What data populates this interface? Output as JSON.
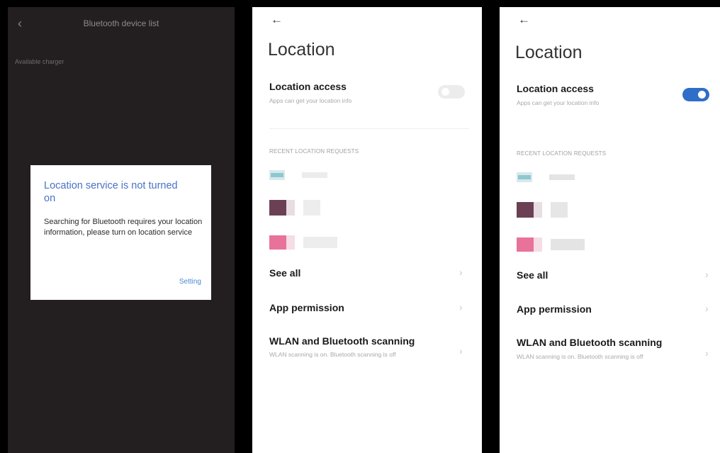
{
  "bluetooth_screen": {
    "title": "Bluetooth device list",
    "back_icon": "‹",
    "available_label": "Available charger",
    "dialog": {
      "title": "Location service is not turned on",
      "message": "Searching for Bluetooth requires your location information, please turn on location service",
      "button": "Setting"
    }
  },
  "location_screen_off": {
    "back_icon": "←",
    "title": "Location",
    "access_title": "Location access",
    "access_subtitle": "Apps can get your location info",
    "access_enabled": false,
    "section_header": "RECENT LOCATION REQUESTS",
    "see_all": "See all",
    "app_permission": "App permission",
    "scanning_title": "WLAN and Bluetooth scanning",
    "scanning_subtitle": "WLAN scanning is on. Bluetooth scanning is off",
    "chevron_icon": "›"
  },
  "location_screen_on": {
    "back_icon": "←",
    "title": "Location",
    "access_title": "Location access",
    "access_subtitle": "Apps can get your location info",
    "access_enabled": true,
    "section_header": "RECENT LOCATION REQUESTS",
    "see_all": "See all",
    "app_permission": "App permission",
    "scanning_title": "WLAN and Bluetooth scanning",
    "scanning_subtitle": "WLAN scanning is on. Bluetooth scanning is off",
    "chevron_icon": "›"
  },
  "colors": {
    "dark_bg": "#231f20",
    "dialog_title": "#4a72c4",
    "toggle_on": "#2f6ec8",
    "toggle_off": "#ececec"
  }
}
